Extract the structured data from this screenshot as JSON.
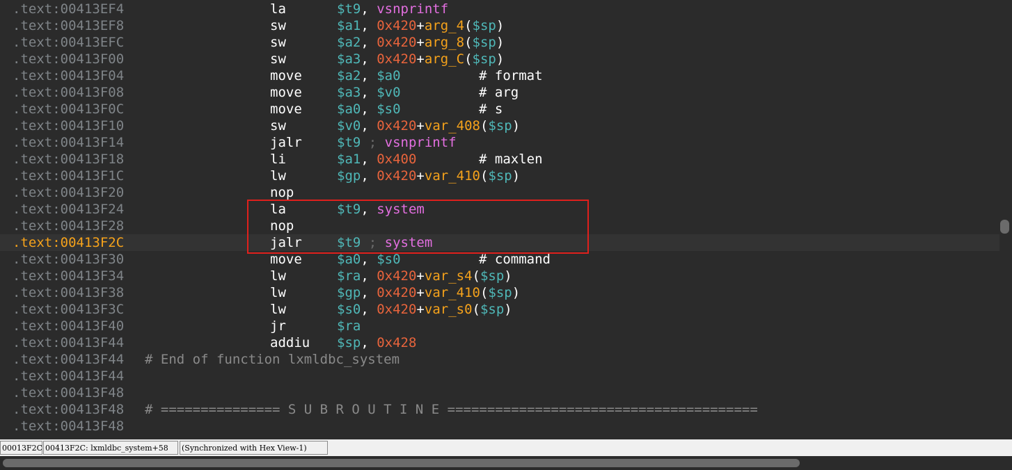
{
  "lines": [
    {
      "addr": ".text:00413EF4",
      "mnem": "la",
      "ops": [
        [
          "reg",
          "$t9"
        ],
        [
          "punc",
          ", "
        ],
        [
          "sym",
          "vsnprintf"
        ]
      ],
      "cmt": ""
    },
    {
      "addr": ".text:00413EF8",
      "mnem": "sw",
      "ops": [
        [
          "reg",
          "$a1"
        ],
        [
          "punc",
          ", "
        ],
        [
          "imm",
          "0x420"
        ],
        [
          "punc",
          "+"
        ],
        [
          "var",
          "arg_4"
        ],
        [
          "punc",
          "("
        ],
        [
          "reg",
          "$sp"
        ],
        [
          "punc",
          ")"
        ]
      ],
      "cmt": ""
    },
    {
      "addr": ".text:00413EFC",
      "mnem": "sw",
      "ops": [
        [
          "reg",
          "$a2"
        ],
        [
          "punc",
          ", "
        ],
        [
          "imm",
          "0x420"
        ],
        [
          "punc",
          "+"
        ],
        [
          "var",
          "arg_8"
        ],
        [
          "punc",
          "("
        ],
        [
          "reg",
          "$sp"
        ],
        [
          "punc",
          ")"
        ]
      ],
      "cmt": ""
    },
    {
      "addr": ".text:00413F00",
      "mnem": "sw",
      "ops": [
        [
          "reg",
          "$a3"
        ],
        [
          "punc",
          ", "
        ],
        [
          "imm",
          "0x420"
        ],
        [
          "punc",
          "+"
        ],
        [
          "var",
          "arg_C"
        ],
        [
          "punc",
          "("
        ],
        [
          "reg",
          "$sp"
        ],
        [
          "punc",
          ")"
        ]
      ],
      "cmt": ""
    },
    {
      "addr": ".text:00413F04",
      "mnem": "move",
      "ops": [
        [
          "reg",
          "$a2"
        ],
        [
          "punc",
          ", "
        ],
        [
          "reg",
          "$a0"
        ]
      ],
      "cmt": "# format"
    },
    {
      "addr": ".text:00413F08",
      "mnem": "move",
      "ops": [
        [
          "reg",
          "$a3"
        ],
        [
          "punc",
          ", "
        ],
        [
          "reg",
          "$v0"
        ]
      ],
      "cmt": "# arg"
    },
    {
      "addr": ".text:00413F0C",
      "mnem": "move",
      "ops": [
        [
          "reg",
          "$a0"
        ],
        [
          "punc",
          ", "
        ],
        [
          "reg",
          "$s0"
        ]
      ],
      "cmt": "# s"
    },
    {
      "addr": ".text:00413F10",
      "mnem": "sw",
      "ops": [
        [
          "reg",
          "$v0"
        ],
        [
          "punc",
          ", "
        ],
        [
          "imm",
          "0x420"
        ],
        [
          "punc",
          "+"
        ],
        [
          "var",
          "var_408"
        ],
        [
          "punc",
          "("
        ],
        [
          "reg",
          "$sp"
        ],
        [
          "punc",
          ")"
        ]
      ],
      "cmt": ""
    },
    {
      "addr": ".text:00413F14",
      "mnem": "jalr",
      "ops": [
        [
          "reg",
          "$t9"
        ],
        [
          "semi",
          " ; "
        ],
        [
          "sym",
          "vsnprintf"
        ]
      ],
      "cmt": ""
    },
    {
      "addr": ".text:00413F18",
      "mnem": "li",
      "ops": [
        [
          "reg",
          "$a1"
        ],
        [
          "punc",
          ", "
        ],
        [
          "imm",
          "0x400"
        ]
      ],
      "cmt": "# maxlen"
    },
    {
      "addr": ".text:00413F1C",
      "mnem": "lw",
      "ops": [
        [
          "reg",
          "$gp"
        ],
        [
          "punc",
          ", "
        ],
        [
          "imm",
          "0x420"
        ],
        [
          "punc",
          "+"
        ],
        [
          "var",
          "var_410"
        ],
        [
          "punc",
          "("
        ],
        [
          "reg",
          "$sp"
        ],
        [
          "punc",
          ")"
        ]
      ],
      "cmt": ""
    },
    {
      "addr": ".text:00413F20",
      "mnem": "nop",
      "ops": [],
      "cmt": ""
    },
    {
      "addr": ".text:00413F24",
      "mnem": "la",
      "ops": [
        [
          "reg",
          "$t9"
        ],
        [
          "punc",
          ", "
        ],
        [
          "sym",
          "system"
        ]
      ],
      "cmt": ""
    },
    {
      "addr": ".text:00413F28",
      "mnem": "nop",
      "ops": [],
      "cmt": ""
    },
    {
      "addr": ".text:00413F2C",
      "mnem": "jalr",
      "ops": [
        [
          "reg",
          "$t9"
        ],
        [
          "semi",
          " ; "
        ],
        [
          "sym",
          "system"
        ]
      ],
      "cmt": "",
      "current": true
    },
    {
      "addr": ".text:00413F30",
      "mnem": "move",
      "ops": [
        [
          "reg",
          "$a0"
        ],
        [
          "punc",
          ", "
        ],
        [
          "reg",
          "$s0"
        ]
      ],
      "cmt": "# command"
    },
    {
      "addr": ".text:00413F34",
      "mnem": "lw",
      "ops": [
        [
          "reg",
          "$ra"
        ],
        [
          "punc",
          ", "
        ],
        [
          "imm",
          "0x420"
        ],
        [
          "punc",
          "+"
        ],
        [
          "var",
          "var_s4"
        ],
        [
          "punc",
          "("
        ],
        [
          "reg",
          "$sp"
        ],
        [
          "punc",
          ")"
        ]
      ],
      "cmt": ""
    },
    {
      "addr": ".text:00413F38",
      "mnem": "lw",
      "ops": [
        [
          "reg",
          "$gp"
        ],
        [
          "punc",
          ", "
        ],
        [
          "imm",
          "0x420"
        ],
        [
          "punc",
          "+"
        ],
        [
          "var",
          "var_410"
        ],
        [
          "punc",
          "("
        ],
        [
          "reg",
          "$sp"
        ],
        [
          "punc",
          ")"
        ]
      ],
      "cmt": ""
    },
    {
      "addr": ".text:00413F3C",
      "mnem": "lw",
      "ops": [
        [
          "reg",
          "$s0"
        ],
        [
          "punc",
          ", "
        ],
        [
          "imm",
          "0x420"
        ],
        [
          "punc",
          "+"
        ],
        [
          "var",
          "var_s0"
        ],
        [
          "punc",
          "("
        ],
        [
          "reg",
          "$sp"
        ],
        [
          "punc",
          ")"
        ]
      ],
      "cmt": ""
    },
    {
      "addr": ".text:00413F40",
      "mnem": "jr",
      "ops": [
        [
          "reg",
          "$ra"
        ]
      ],
      "cmt": ""
    },
    {
      "addr": ".text:00413F44",
      "mnem": "addiu",
      "ops": [
        [
          "reg",
          "$sp"
        ],
        [
          "punc",
          ", "
        ],
        [
          "imm",
          "0x428"
        ]
      ],
      "cmt": ""
    },
    {
      "addr": ".text:00413F44",
      "fcmt": "# End of function lxmldbc_system"
    },
    {
      "addr": ".text:00413F44",
      "fcmt": ""
    },
    {
      "addr": ".text:00413F48",
      "fcmt": ""
    },
    {
      "addr": ".text:00413F48",
      "fcmt": "# =============== S U B R O U T I N E ======================================="
    },
    {
      "addr": ".text:00413F48",
      "fcmt": ""
    }
  ],
  "status": {
    "offset": "00013F2C",
    "location": "00413F2C: lxmldbc_system+58",
    "sync": "(Synchronized with Hex View-1)"
  },
  "colors": {
    "background": "#2b2b2b",
    "address": "#7f8488",
    "current_address": "#f5a21b",
    "register": "#4fb8b8",
    "immediate": "#e8643c",
    "variable": "#f5a21b",
    "symbol": "#e36fe0",
    "highlight_box": "#e0201c"
  }
}
